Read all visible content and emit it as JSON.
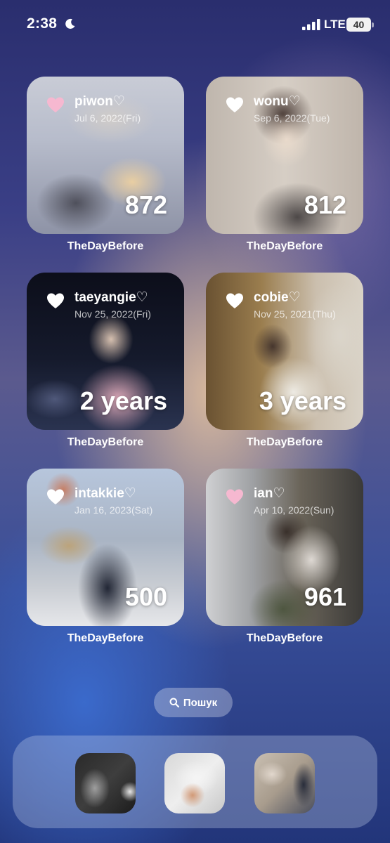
{
  "status_bar": {
    "time": "2:38",
    "network": "LTE",
    "battery": "40"
  },
  "widgets": [
    {
      "name": "piwon♡",
      "date": "Jul 6, 2022(Fri)",
      "count": "872",
      "label": "TheDayBefore",
      "heart_color": "#f6b8d0"
    },
    {
      "name": "wonu♡",
      "date": "Sep 6, 2022(Tue)",
      "count": "812",
      "label": "TheDayBefore",
      "heart_color": "#ffffff"
    },
    {
      "name": "taeyangie♡",
      "date": "Nov 25, 2022(Fri)",
      "count": "2 years",
      "label": "TheDayBefore",
      "heart_color": "#ffffff"
    },
    {
      "name": "cobie♡",
      "date": "Nov 25, 2021(Thu)",
      "count": "3 years",
      "label": "TheDayBefore",
      "heart_color": "#ffffff"
    },
    {
      "name": "intakkie♡",
      "date": "Jan 16, 2023(Sat)",
      "count": "500",
      "label": "TheDayBefore",
      "heart_color": "#ffffff"
    },
    {
      "name": "ian♡",
      "date": "Apr 10, 2022(Sun)",
      "count": "961",
      "label": "TheDayBefore",
      "heart_color": "#f6b8d0"
    }
  ],
  "search": {
    "label": "Пошук"
  },
  "dock": {
    "apps": [
      {
        "name": "dock-app-1"
      },
      {
        "name": "dock-app-2"
      },
      {
        "name": "dock-app-3"
      }
    ]
  }
}
